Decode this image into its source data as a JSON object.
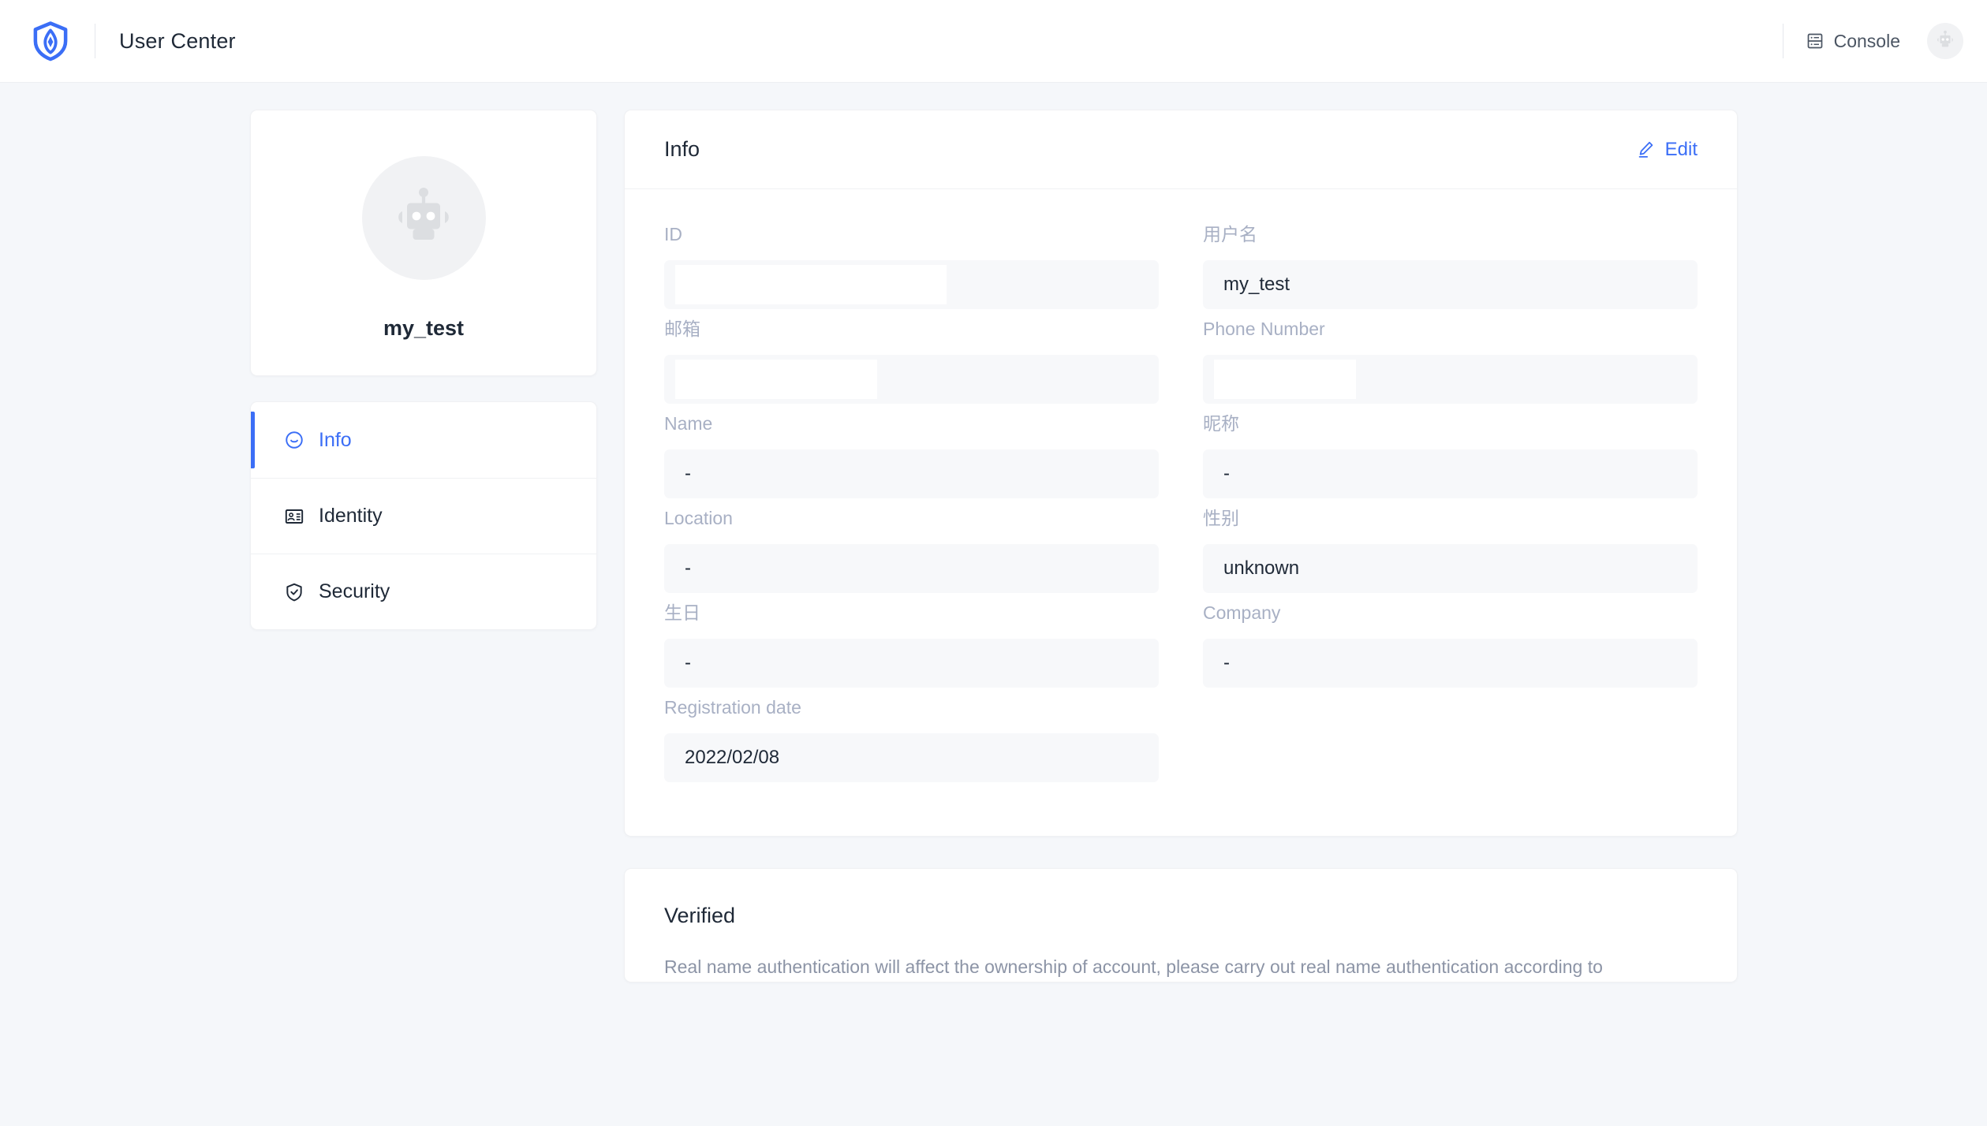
{
  "header": {
    "logo_icon": "shield-logo-icon",
    "title": "User Center",
    "console_label": "Console",
    "console_icon": "server-icon",
    "avatar_icon": "robot-avatar-icon"
  },
  "colors": {
    "accent": "#3b6ef6",
    "page_bg": "#f5f7fa",
    "card_bg": "#ffffff",
    "field_bg": "#f7f8fa",
    "label_text": "#a8b0c4",
    "body_text": "#1f2937",
    "muted_text": "#8c94a6"
  },
  "profile": {
    "avatar_icon": "robot-avatar-icon",
    "name": "my_test"
  },
  "sidebar": {
    "items": [
      {
        "label": "Info",
        "icon": "smiley-face-icon",
        "active": true
      },
      {
        "label": "Identity",
        "icon": "id-card-icon",
        "active": false
      },
      {
        "label": "Security",
        "icon": "shield-check-icon",
        "active": false
      }
    ]
  },
  "info": {
    "title": "Info",
    "edit_label": "Edit",
    "edit_icon": "pencil-icon",
    "fields": [
      {
        "label": "ID",
        "value": "",
        "redacted": "w-id"
      },
      {
        "label": "用户名",
        "value": "my_test",
        "redacted": ""
      },
      {
        "label": "邮箱",
        "value": "",
        "redacted": "w-email"
      },
      {
        "label": "Phone Number",
        "value": "",
        "redacted": "w-phone"
      },
      {
        "label": "Name",
        "value": "-",
        "redacted": ""
      },
      {
        "label": "昵称",
        "value": "-",
        "redacted": ""
      },
      {
        "label": "Location",
        "value": "-",
        "redacted": ""
      },
      {
        "label": "性别",
        "value": "unknown",
        "redacted": ""
      },
      {
        "label": "生日",
        "value": "-",
        "redacted": ""
      },
      {
        "label": "Company",
        "value": "-",
        "redacted": ""
      },
      {
        "label": "Registration date",
        "value": "2022/02/08",
        "redacted": ""
      }
    ]
  },
  "verified": {
    "title": "Verified",
    "description": "Real name authentication will affect the ownership of account, please carry out real name authentication according to"
  }
}
